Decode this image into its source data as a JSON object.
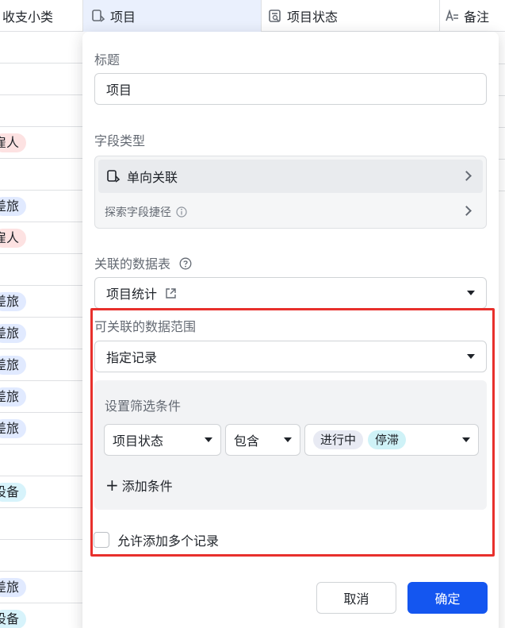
{
  "table": {
    "columns": [
      {
        "label": "收支小类"
      },
      {
        "label": "项目",
        "icon": "link-field-icon"
      },
      {
        "label": "项目状态",
        "icon": "form-field-icon"
      },
      {
        "label": "备注",
        "icon": "text-field-icon"
      }
    ],
    "row_tags": [
      {
        "text": "雇人",
        "color": "red"
      },
      {
        "text": "差旅",
        "color": "blue"
      },
      {
        "text": "雇人",
        "color": "red"
      },
      {
        "text": "差旅",
        "color": "blue"
      },
      {
        "text": "差旅",
        "color": "blue"
      },
      {
        "text": "差旅",
        "color": "blue"
      },
      {
        "text": "差旅",
        "color": "blue"
      },
      {
        "text": "差旅",
        "color": "blue"
      },
      {
        "text": "设备",
        "color": "cyan"
      },
      {
        "text": "差旅",
        "color": "blue"
      },
      {
        "text": "设备",
        "color": "cyan"
      }
    ]
  },
  "dialog": {
    "title_label": "标题",
    "title_value": "项目",
    "field_type_label": "字段类型",
    "field_type_value": "单向关联",
    "shortcut_label": "探索字段捷径",
    "linked_table_label": "关联的数据表",
    "linked_table_value": "项目统计",
    "range_label": "可关联的数据范围",
    "range_value": "指定记录",
    "filter": {
      "title": "设置筛选条件",
      "field": "项目状态",
      "operator": "包含",
      "values": [
        "进行中",
        "停滞"
      ],
      "add_condition": "添加条件"
    },
    "allow_multiple_label": "允许添加多个记录",
    "allow_multiple_checked": false,
    "cancel_label": "取消",
    "confirm_label": "确定"
  },
  "colors": {
    "primary": "#1456f0",
    "highlight_border": "#e8302c",
    "tag_red": "#fde2e2",
    "tag_blue": "#e1eaff",
    "tag_cyan": "#d7f3fb"
  }
}
